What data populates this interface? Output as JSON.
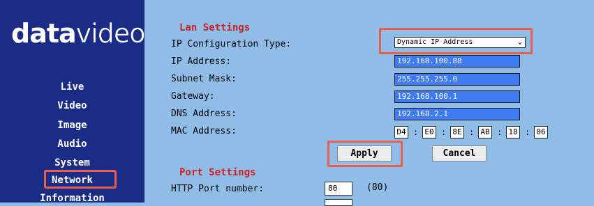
{
  "brand": {
    "logo_bold": "data",
    "logo_light": "video"
  },
  "sidebar": {
    "items": [
      {
        "label": "Live"
      },
      {
        "label": "Video"
      },
      {
        "label": "Image"
      },
      {
        "label": "Audio"
      },
      {
        "label": "System"
      },
      {
        "label": "Network"
      },
      {
        "label": "Information"
      }
    ],
    "active": "Network"
  },
  "lan": {
    "title": "Lan Settings",
    "ip_type_label": "IP Configuration Type:",
    "ip_type_value": "Dynamic IP Address",
    "ip_label": "IP Address:",
    "ip_value": "192.168.100.88",
    "mask_label": "Subnet Mask:",
    "mask_value": "255.255.255.0",
    "gateway_label": "Gateway:",
    "gateway_value": "192.168.100.1",
    "dns_label": "DNS Address:",
    "dns_value": "192.168.2.1",
    "mac_label": "MAC Address:",
    "mac": [
      "D4",
      "E0",
      "8E",
      "AB",
      "18",
      "06"
    ],
    "mac_sep": ":"
  },
  "buttons": {
    "apply": "Apply",
    "cancel": "Cancel"
  },
  "port": {
    "title": "Port Settings",
    "http_label": "HTTP Port number:",
    "http_value": "80",
    "http_default": "(80)"
  },
  "colors": {
    "sidebar": "#1b2c86",
    "background": "#8fbde8",
    "field": "#3f7cf4",
    "highlight": "#e8604c",
    "section_title": "#cc2222"
  }
}
